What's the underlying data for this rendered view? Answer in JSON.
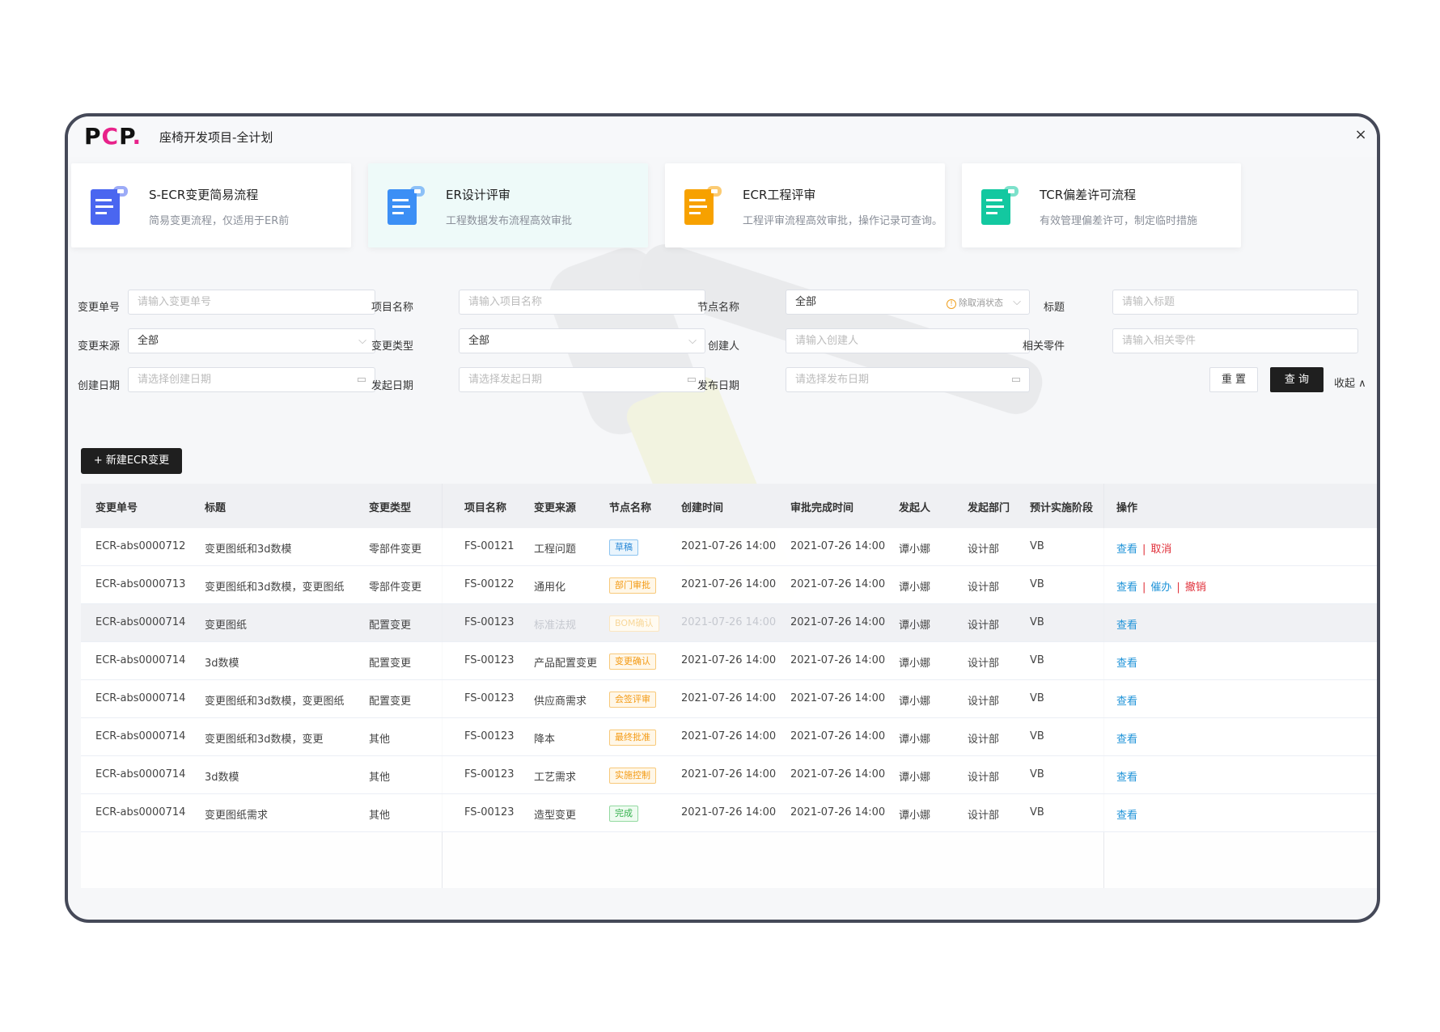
{
  "app": {
    "logo": {
      "p": "P",
      "c": "C",
      "p2": "P",
      "dot": "."
    },
    "title": "座椅开发项目-全计划",
    "close_icon": "×"
  },
  "cards": [
    {
      "title": "S-ECR变更简易流程",
      "desc": "简易变更流程，仅适用于ER前",
      "icon": "document-icon",
      "color": "#4a66f0"
    },
    {
      "title": "ER设计评审",
      "desc": "工程数据发布流程高效审批",
      "icon": "document-icon",
      "color": "#3c8ff5"
    },
    {
      "title": "ECR工程评审",
      "desc": "工程评审流程高效审批，操作记录可查询。",
      "icon": "document-icon",
      "color": "#f7a100"
    },
    {
      "title": "TCR偏差许可流程",
      "desc": "有效管理偏差许可，制定临时措施",
      "icon": "document-icon",
      "color": "#13c8a0"
    }
  ],
  "filters": {
    "change_no": {
      "label": "变更单号",
      "placeholder": "请输入变更单号"
    },
    "project_name": {
      "label": "项目名称",
      "placeholder": "请输入项目名称"
    },
    "node_name": {
      "label": "节点名称",
      "value": "全部",
      "hint": "除取消状态"
    },
    "title": {
      "label": "标题",
      "placeholder": "请输入标题"
    },
    "change_source": {
      "label": "变更来源",
      "value": "全部"
    },
    "change_type": {
      "label": "变更类型",
      "value": "全部"
    },
    "creator": {
      "label": "创建人",
      "placeholder": "请输入创建人"
    },
    "related_parts": {
      "label": "相关零件",
      "placeholder": "请输入相关零件"
    },
    "create_date": {
      "label": "创建日期",
      "placeholder": "请选择创建日期"
    },
    "launch_date": {
      "label": "发起日期",
      "placeholder": "请选择发起日期"
    },
    "publish_date": {
      "label": "发布日期",
      "placeholder": "请选择发布日期"
    },
    "reset_label": "重 置",
    "query_label": "查 询",
    "collapse_label": "收起"
  },
  "new_button": "新建ECR变更",
  "table": {
    "headers": [
      "变更单号",
      "标题",
      "变更类型",
      "项目名称",
      "变更来源",
      "节点名称",
      "创建时间",
      "审批完成时间",
      "发起人",
      "发起部门",
      "预计实施阶段",
      "操作"
    ],
    "rows": [
      {
        "no": "ECR-abs0000712",
        "title": "变更图纸和3d数模",
        "type": "零部件变更",
        "project": "FS-00121",
        "source": "工程问题",
        "node": "草稿",
        "node_color": "blue",
        "created": "2021-07-26 14:00",
        "approved": "2021-07-26 14:00",
        "initiator": "谭小娜",
        "dept": "设计部",
        "stage": "VB",
        "ops": [
          {
            "label": "查看",
            "color": "blue"
          },
          {
            "label": "取消",
            "color": "red"
          }
        ]
      },
      {
        "no": "ECR-abs0000713",
        "title": "变更图纸和3d数模，变更图纸",
        "type": "零部件变更",
        "project": "FS-00122",
        "source": "通用化",
        "node": "部门审批",
        "node_color": "orange",
        "created": "2021-07-26 14:00",
        "approved": "2021-07-26 14:00",
        "initiator": "谭小娜",
        "dept": "设计部",
        "stage": "VB",
        "ops": [
          {
            "label": "查看",
            "color": "blue"
          },
          {
            "label": "催办",
            "color": "blue"
          },
          {
            "label": "撤销",
            "color": "red"
          }
        ]
      },
      {
        "no": "ECR-abs0000714",
        "title": "变更图纸",
        "type": "配置变更",
        "project": "FS-00123",
        "source": "标准法规",
        "node": "BOM确认",
        "node_color": "orange",
        "created": "2021-07-26 14:00",
        "approved": "2021-07-26 14:00",
        "initiator": "谭小娜",
        "dept": "设计部",
        "stage": "VB",
        "ops": [
          {
            "label": "查看",
            "color": "blue"
          }
        ]
      },
      {
        "no": "ECR-abs0000714",
        "title": "3d数模",
        "type": "配置变更",
        "project": "FS-00123",
        "source": "产品配置变更",
        "node": "变更确认",
        "node_color": "orange",
        "created": "2021-07-26 14:00",
        "approved": "2021-07-26 14:00",
        "initiator": "谭小娜",
        "dept": "设计部",
        "stage": "VB",
        "ops": [
          {
            "label": "查看",
            "color": "blue"
          }
        ]
      },
      {
        "no": "ECR-abs0000714",
        "title": "变更图纸和3d数模，变更图纸",
        "type": "配置变更",
        "project": "FS-00123",
        "source": "供应商需求",
        "node": "会签评审",
        "node_color": "orange",
        "created": "2021-07-26 14:00",
        "approved": "2021-07-26 14:00",
        "initiator": "谭小娜",
        "dept": "设计部",
        "stage": "VB",
        "ops": [
          {
            "label": "查看",
            "color": "blue"
          }
        ]
      },
      {
        "no": "ECR-abs0000714",
        "title": "变更图纸和3d数模，变更",
        "type": "其他",
        "project": "FS-00123",
        "source": "降本",
        "node": "最终批准",
        "node_color": "orange",
        "created": "2021-07-26 14:00",
        "approved": "2021-07-26 14:00",
        "initiator": "谭小娜",
        "dept": "设计部",
        "stage": "VB",
        "ops": [
          {
            "label": "查看",
            "color": "blue"
          }
        ]
      },
      {
        "no": "ECR-abs0000714",
        "title": "3d数模",
        "type": "其他",
        "project": "FS-00123",
        "source": "工艺需求",
        "node": "实施控制",
        "node_color": "orange",
        "created": "2021-07-26 14:00",
        "approved": "2021-07-26 14:00",
        "initiator": "谭小娜",
        "dept": "设计部",
        "stage": "VB",
        "ops": [
          {
            "label": "查看",
            "color": "blue"
          }
        ]
      },
      {
        "no": "ECR-abs0000714",
        "title": "变更图纸需求",
        "type": "其他",
        "project": "FS-00123",
        "source": "造型变更",
        "node": "完成",
        "node_color": "green",
        "created": "2021-07-26 14:00",
        "approved": "2021-07-26 14:00",
        "initiator": "谭小娜",
        "dept": "设计部",
        "stage": "VB",
        "ops": [
          {
            "label": "查看",
            "color": "blue"
          }
        ]
      }
    ]
  }
}
